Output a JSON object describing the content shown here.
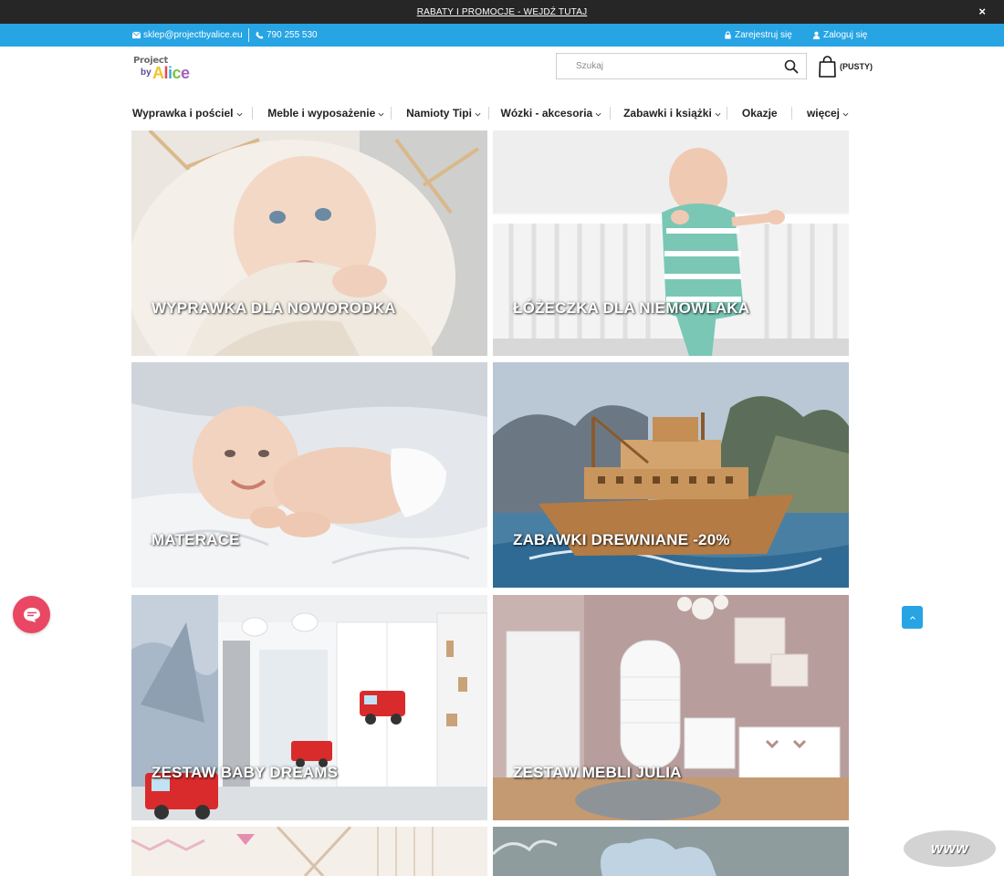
{
  "promo": {
    "text": "RABATY I PROMOCJE - WEJDŹ TUTAJ",
    "close_icon": "×"
  },
  "contact": {
    "email": "sklep@projectbyalice.eu",
    "phone": "790 255 530",
    "register": "Zarejestruj się",
    "login": "Zaloguj się"
  },
  "logo": {
    "line1": "Project",
    "by": "by",
    "brand": "Alice"
  },
  "search": {
    "placeholder": "Szukaj"
  },
  "cart": {
    "label": "(PUSTY)"
  },
  "nav": {
    "items": [
      {
        "label": "Wyprawka i pościel",
        "has_dropdown": true
      },
      {
        "label": "Meble i wyposażenie",
        "has_dropdown": true
      },
      {
        "label": "Namioty Tipi",
        "has_dropdown": true
      },
      {
        "label": "Wózki - akcesoria",
        "has_dropdown": true
      },
      {
        "label": "Zabawki i książki",
        "has_dropdown": true
      },
      {
        "label": "Okazje",
        "has_dropdown": false
      },
      {
        "label": "więcej",
        "has_dropdown": true
      }
    ]
  },
  "tiles": [
    {
      "label": "WYPRAWKA DLA NOWORODKA"
    },
    {
      "label": "ŁÓŻECZKA DLA NIEMOWLAKA"
    },
    {
      "label": "MATERACE"
    },
    {
      "label": "ZABAWKI DREWNIANE -20%"
    },
    {
      "label": "ZESTAW BABY DREAMS"
    },
    {
      "label": "ZESTAW MEBLI JULIA"
    }
  ],
  "badge": {
    "www": "www"
  },
  "colors": {
    "accent": "#27a4e3",
    "promo_bg": "#262626",
    "chat": "#e94763"
  }
}
